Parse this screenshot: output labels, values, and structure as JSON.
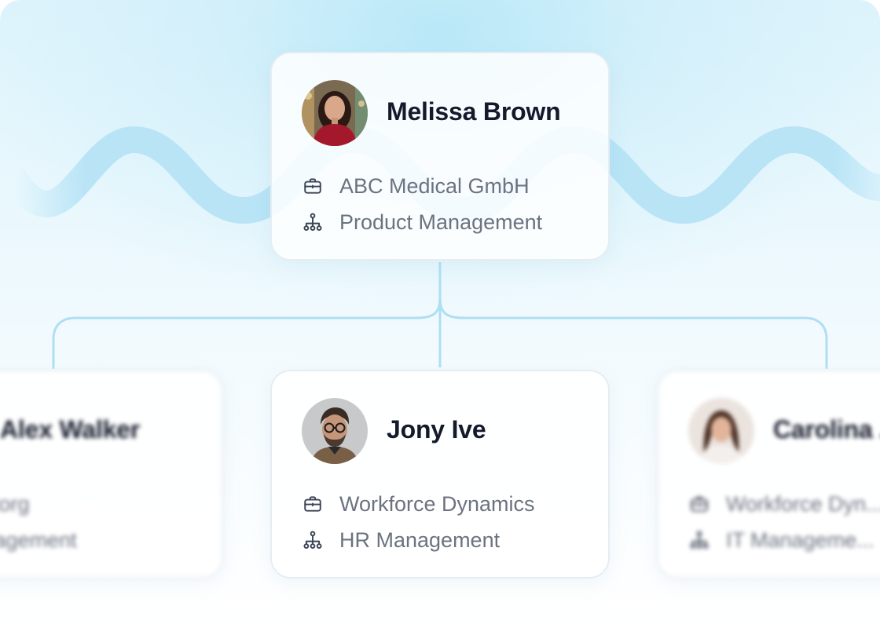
{
  "manager": {
    "name": "Melissa Brown",
    "company": "ABC Medical GmbH",
    "department": "Product Management",
    "icons": {
      "company": "briefcase-icon",
      "department": "org-chart-icon"
    }
  },
  "reports": [
    {
      "name": "Alex Walker",
      "company": "...estorg",
      "department": "...anagement",
      "blurred": true
    },
    {
      "name": "Jony Ive",
      "company": "Workforce Dynamics",
      "department": "HR Management",
      "blurred": false
    },
    {
      "name": "Carolina ...",
      "company": "Workforce Dyn...",
      "department": "IT Manageme...",
      "blurred": true
    }
  ],
  "colors": {
    "accent": "#b5e3f5",
    "connector": "#b0def3",
    "name_text": "#141a2b",
    "detail_text": "#6b7380",
    "icon": "#3b4456"
  }
}
